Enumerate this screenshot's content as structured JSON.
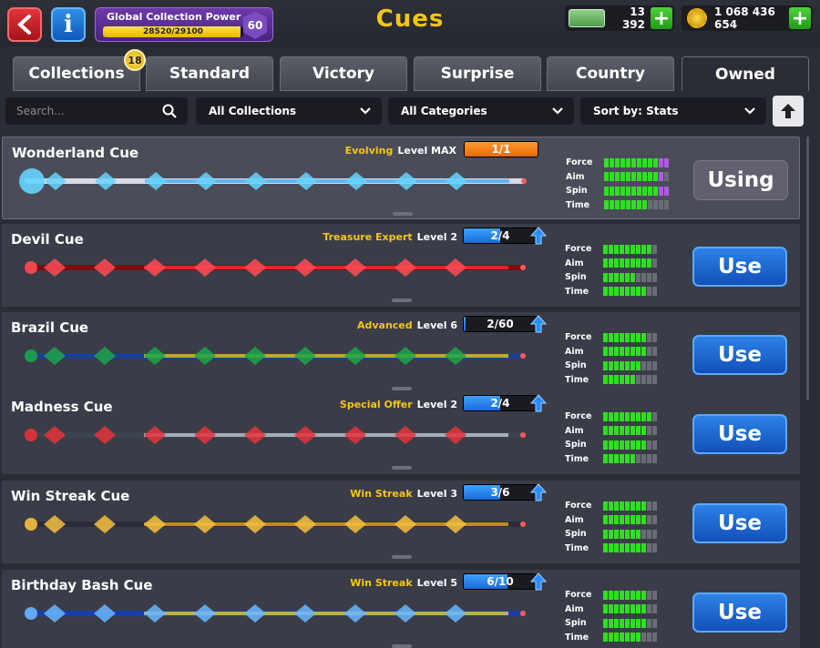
{
  "header": {
    "title": "Cues",
    "power": {
      "label": "Global Collection Power",
      "progress_text": "28520/29100",
      "current": 28520,
      "max": 29100,
      "level": "60"
    },
    "cash": "13 392",
    "coins": "1 068 436 654"
  },
  "tabs": [
    {
      "label": "Collections",
      "badge": "18"
    },
    {
      "label": "Standard"
    },
    {
      "label": "Victory"
    },
    {
      "label": "Surprise"
    },
    {
      "label": "Country"
    },
    {
      "label": "Owned",
      "active": true
    }
  ],
  "filters": {
    "search_placeholder": "Search...",
    "collection": "All Collections",
    "category": "All Categories",
    "sort": "Sort by: Stats"
  },
  "stat_labels": [
    "Force",
    "Aim",
    "Spin",
    "Time"
  ],
  "cues": [
    {
      "name": "Wonderland Cue",
      "tag": "Evolving",
      "level": "Level MAX",
      "progress": "1/1",
      "fraction": 1.0,
      "max": true,
      "button": "Using",
      "selected": true,
      "stats": {
        "force": 10,
        "aim": 10,
        "spin": 10,
        "time": 8
      },
      "extra": {
        "force": 2,
        "aim": 1,
        "spin": 2,
        "time": 0
      }
    },
    {
      "name": "Devil Cue",
      "tag": "Treasure Expert",
      "level": "Level 2",
      "progress": "2/4",
      "fraction": 0.5,
      "button": "Use",
      "stats": {
        "force": 9,
        "aim": 9,
        "spin": 6,
        "time": 8
      }
    },
    {
      "name": "Brazil Cue",
      "tag": "Advanced",
      "level": "Level 6",
      "progress": "2/60",
      "fraction": 0.03,
      "button": "Use",
      "stats": {
        "force": 8,
        "aim": 8,
        "spin": 7,
        "time": 6
      }
    },
    {
      "name": "Madness Cue",
      "tag": "Special Offer",
      "level": "Level 2",
      "progress": "2/4",
      "fraction": 0.5,
      "button": "Use",
      "stats": {
        "force": 9,
        "aim": 8,
        "spin": 8,
        "time": 6
      }
    },
    {
      "name": "Win Streak Cue",
      "tag": "Win Streak",
      "level": "Level 3",
      "progress": "3/6",
      "fraction": 0.5,
      "button": "Use",
      "stats": {
        "force": 8,
        "aim": 8,
        "spin": 7,
        "time": 8
      }
    },
    {
      "name": "Birthday Bash Cue",
      "tag": "Win Streak",
      "level": "Level 5",
      "progress": "6/10",
      "fraction": 0.6,
      "button": "Use",
      "stats": {
        "force": 8,
        "aim": 8,
        "spin": 8,
        "time": 7
      }
    }
  ]
}
